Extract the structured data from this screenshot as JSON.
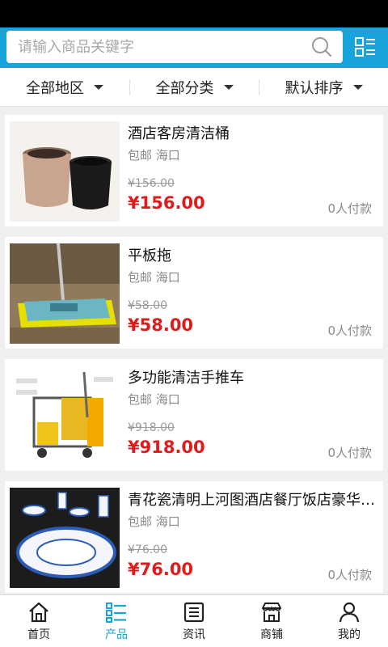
{
  "search": {
    "placeholder": "请输入商品关键字"
  },
  "filters": [
    {
      "label": "全部地区"
    },
    {
      "label": "全部分类"
    },
    {
      "label": "默认排序"
    }
  ],
  "products": [
    {
      "title": "酒店客房清洁桶",
      "meta": "包邮 海口",
      "old_price": "¥156.00",
      "price": "¥156.00",
      "sales": "0人付款"
    },
    {
      "title": "平板拖",
      "meta": "包邮 海口",
      "old_price": "¥58.00",
      "price": "¥58.00",
      "sales": "0人付款"
    },
    {
      "title": "多功能清洁手推车",
      "meta": "包邮 海口",
      "old_price": "¥918.00",
      "price": "¥918.00",
      "sales": "0人付款"
    },
    {
      "title": "青花瓷清明上河图酒店餐厅饭店豪华餐具套装",
      "meta": "包邮 海口",
      "old_price": "¥76.00",
      "price": "¥76.00",
      "sales": "0人付款"
    }
  ],
  "tabs": [
    {
      "label": "首页",
      "icon": "home-icon"
    },
    {
      "label": "产品",
      "icon": "product-list-icon"
    },
    {
      "label": "资讯",
      "icon": "news-icon"
    },
    {
      "label": "商铺",
      "icon": "store-icon"
    },
    {
      "label": "我的",
      "icon": "user-icon"
    }
  ],
  "colors": {
    "accent": "#17a4dc",
    "price": "#e01b1b"
  }
}
